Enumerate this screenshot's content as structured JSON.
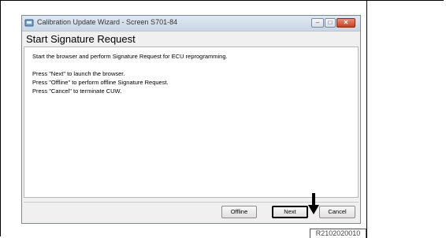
{
  "window": {
    "title": "Calibration Update Wizard - Screen S701-84",
    "heading": "Start Signature Request"
  },
  "body_text": {
    "line1": "Start the browser and perform Signature Request for ECU reprogramming.",
    "line2": "Press \"Next\" to launch the browser.",
    "line3": "Press \"Offline\" to perform offline Signature Request.",
    "line4": "Press \"Cancel\" to terminate CUW."
  },
  "buttons": {
    "offline": "Offline",
    "next": "Next",
    "cancel": "Cancel"
  },
  "window_controls": {
    "minimize": "–",
    "maximize": "□",
    "close": "✕"
  },
  "figure_code": "R2102020010",
  "colors": {
    "close_button": "#c6401f",
    "titlebar": "#c9d6e4"
  }
}
